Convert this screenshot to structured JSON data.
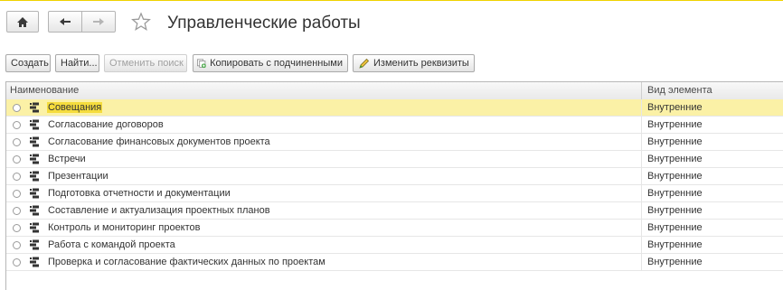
{
  "window": {
    "title": "Управленческие работы"
  },
  "toolbar": {
    "create": "Создать",
    "find": "Найти...",
    "cancel_search": "Отменить поиск",
    "copy_with_children": "Копировать с подчиненными",
    "change_attributes": "Изменить реквизиты"
  },
  "table": {
    "columns": [
      "Наименование",
      "Вид элемента"
    ],
    "rows": [
      {
        "name": "Совещания",
        "kind": "Внутренние"
      },
      {
        "name": "Согласование договоров",
        "kind": "Внутренние"
      },
      {
        "name": "Согласование финансовых документов проекта",
        "kind": "Внутренние"
      },
      {
        "name": "Встречи",
        "kind": "Внутренние"
      },
      {
        "name": "Презентации",
        "kind": "Внутренние"
      },
      {
        "name": "Подготовка отчетности и документации",
        "kind": "Внутренние"
      },
      {
        "name": "Составление и актуализация проектных планов",
        "kind": "Внутренние"
      },
      {
        "name": "Контроль и мониторинг проектов",
        "kind": "Внутренние"
      },
      {
        "name": "Работа с командой проекта",
        "kind": "Внутренние"
      },
      {
        "name": "Проверка и согласование фактических данных по проектам",
        "kind": "Внутренние"
      }
    ]
  }
}
